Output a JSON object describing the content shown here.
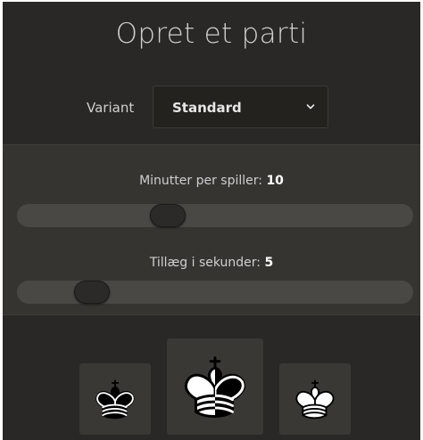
{
  "dialog": {
    "title": "Opret et parti"
  },
  "variant": {
    "label": "Variant",
    "selected": "Standard"
  },
  "time": {
    "minutes_label": "Minutter per spiller: ",
    "minutes_value": "10",
    "minutes_fraction": 0.38,
    "increment_label": "Tillæg i sekunder: ",
    "increment_value": "5",
    "increment_fraction": 0.19
  },
  "color_choices": [
    {
      "icon": "black-king-icon"
    },
    {
      "icon": "random-king-icon"
    },
    {
      "icon": "white-king-icon"
    }
  ],
  "colors": {
    "background": "#2a2826",
    "panel": "#363431",
    "track": "#4a4845",
    "text": "#cfcfcf"
  }
}
